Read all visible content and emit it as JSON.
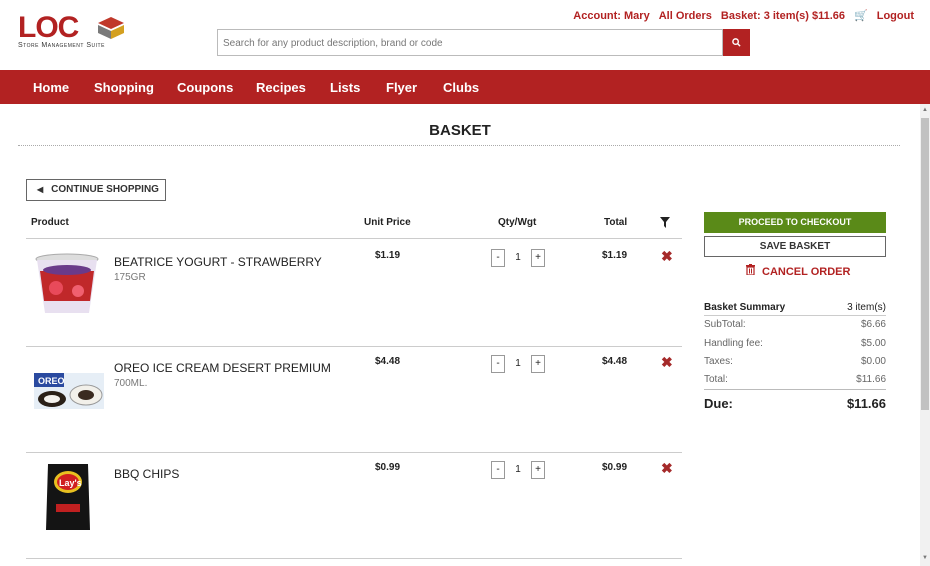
{
  "header": {
    "logo_text": "LOC",
    "logo_subtitle": "Store Management Suite",
    "account_link": "Account: Mary",
    "orders_link": "All Orders",
    "basket_link": "Basket: 3 item(s) $11.66",
    "logout_link": "Logout",
    "search_placeholder": "Search for any product description, brand or code"
  },
  "nav": {
    "items": [
      "Home",
      "Shopping",
      "Coupons",
      "Recipes",
      "Lists",
      "Flyer",
      "Clubs"
    ]
  },
  "page": {
    "title": "BASKET",
    "continue_label": "CONTINUE SHOPPING"
  },
  "table": {
    "headers": {
      "product": "Product",
      "unit_price": "Unit Price",
      "qty": "Qty/Wgt",
      "total": "Total"
    },
    "rows": [
      {
        "name": "BEATRICE YOGURT - STRAWBERRY",
        "size": "175GR",
        "unit_price": "$1.19",
        "qty": "1",
        "total": "$1.19"
      },
      {
        "name": "OREO ICE CREAM DESERT PREMIUM",
        "size": "700ML.",
        "unit_price": "$4.48",
        "qty": "1",
        "total": "$4.48"
      },
      {
        "name": "BBQ CHIPS",
        "size": "",
        "unit_price": "$0.99",
        "qty": "1",
        "total": "$0.99"
      }
    ]
  },
  "sidebar": {
    "checkout_label": "PROCEED TO CHECKOUT",
    "save_label": "SAVE BASKET",
    "cancel_label": "CANCEL ORDER",
    "summary": {
      "title": "Basket Summary",
      "count": "3 item(s)",
      "rows": [
        {
          "label": "SubTotal:",
          "value": "$6.66"
        },
        {
          "label": "Handling fee:",
          "value": "$5.00"
        },
        {
          "label": "Taxes:",
          "value": "$0.00"
        },
        {
          "label": "Total:",
          "value": "$11.66"
        }
      ],
      "due_label": "Due:",
      "due_value": "$11.66"
    }
  },
  "colors": {
    "brand": "#b22222",
    "checkout": "#5a8a18"
  }
}
